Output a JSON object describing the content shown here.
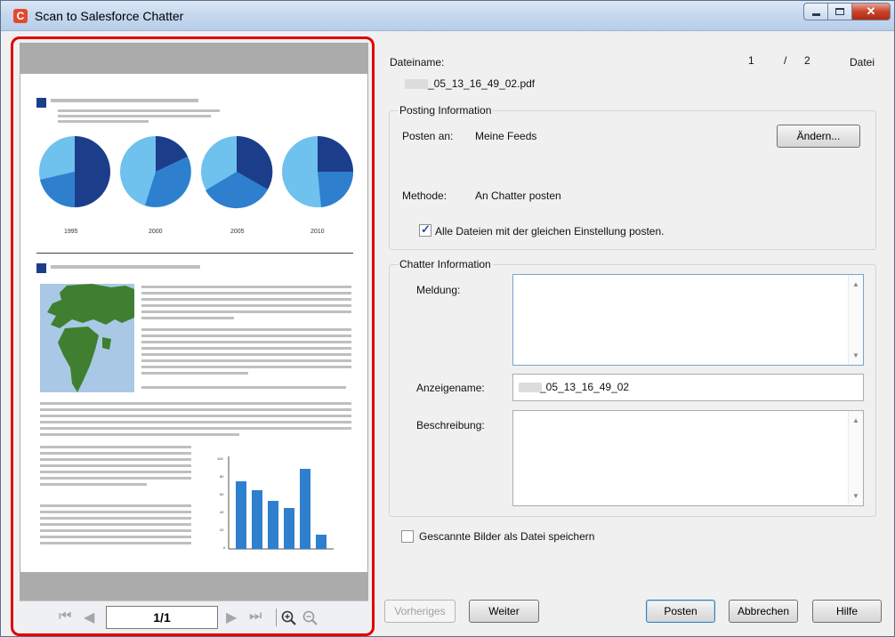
{
  "window": {
    "title": "Scan to Salesforce Chatter",
    "icon": "salesforce-c-icon",
    "controls": [
      "minimize",
      "maximize",
      "close"
    ]
  },
  "preview": {
    "years": [
      "1995",
      "2000",
      "2005",
      "2010"
    ],
    "bar_axis": [
      "100",
      "80",
      "60",
      "40",
      "20",
      "0"
    ],
    "page_indicator": "1/1",
    "colors": {
      "dark": "#1c3e8a",
      "mid": "#2f7fcf",
      "light": "#6fc1ee",
      "map_land": "#3f7f2f",
      "map_sea": "#a9c8e6",
      "highlight": "#e10000"
    }
  },
  "file": {
    "label": "Dateiname:",
    "name": "_05_13_16_49_02.pdf",
    "counter_current": "1",
    "counter_sep": "/",
    "counter_total": "2",
    "counter_unit": "Datei"
  },
  "posting": {
    "legend": "Posting Information",
    "post_to_label": "Posten an:",
    "post_to_value": "Meine Feeds",
    "change_button": "Ändern...",
    "method_label": "Methode:",
    "method_value": "An Chatter posten",
    "all_files_checkbox": "Alle Dateien mit der gleichen Einstellung posten.",
    "all_files_checked": true
  },
  "chatter": {
    "legend": "Chatter Information",
    "message_label": "Meldung:",
    "message_value": "",
    "display_name_label": "Anzeigename:",
    "display_name_value": "_05_13_16_49_02",
    "description_label": "Beschreibung:",
    "description_value": ""
  },
  "save_images": {
    "label": "Gescannte Bilder als Datei speichern",
    "checked": false
  },
  "buttons": {
    "previous": "Vorheriges",
    "next": "Weiter",
    "post": "Posten",
    "cancel": "Abbrechen",
    "help": "Hilfe"
  }
}
